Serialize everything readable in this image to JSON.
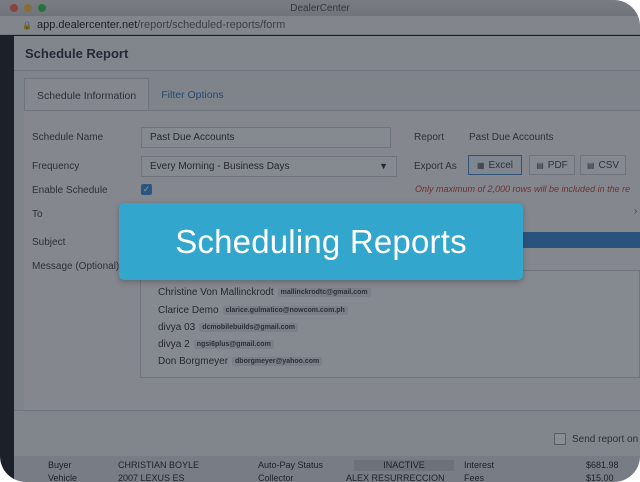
{
  "window": {
    "title": "DealerCenter"
  },
  "browser": {
    "url_host": "app.dealercenter.net",
    "url_path": "/report/scheduled-reports/form"
  },
  "header": {
    "title": "Schedule Report"
  },
  "tabs": [
    {
      "label": "Schedule Information",
      "active": true
    },
    {
      "label": "Filter Options",
      "active": false
    }
  ],
  "form": {
    "schedule_name_label": "Schedule Name",
    "schedule_name_value": "Past Due Accounts",
    "frequency_label": "Frequency",
    "frequency_value": "Every Morning - Business Days",
    "enable_label": "Enable Schedule",
    "enable_checked": true,
    "to_label": "To",
    "subject_label": "Subject",
    "message_label": "Message (Optional)",
    "report_label": "Report",
    "report_value": "Past Due Accounts",
    "export_label": "Export As",
    "export_options": [
      "Excel",
      "PDF",
      "CSV"
    ],
    "export_selected": "Excel",
    "warning": "Only maximum of 2,000 rows will be included in the re"
  },
  "recipients": [
    {
      "name": "Christine Von Mallinckrodt",
      "email": "mallinckrodtc@gmail.com"
    },
    {
      "name": "Clarice Demo",
      "email": "clarice.gulmatico@nowcom.com.ph"
    },
    {
      "name": "divya 03",
      "email": "dcmobilebuilds@gmail.com"
    },
    {
      "name": "divya 2",
      "email": "ngsi6plus@gmail.com"
    },
    {
      "name": "Don Borgmeyer",
      "email": "dborgmeyer@yahoo.com"
    }
  ],
  "footer": {
    "send_label": "Send report on save"
  },
  "background_table": {
    "row1": [
      "Buyer",
      "CHRISTIAN BOYLE",
      "Auto-Pay Status",
      "INACTIVE",
      "Interest",
      "$681.98"
    ],
    "row2": [
      "Vehicle",
      "2007 LEXUS ES",
      "Collector",
      "ALEX RESURRECCION",
      "Fees",
      "$15.00"
    ]
  },
  "banner": {
    "text": "Scheduling Reports"
  },
  "colors": {
    "accent": "#32a6cc",
    "link": "#1f6fb7",
    "warning": "#c0392b"
  }
}
